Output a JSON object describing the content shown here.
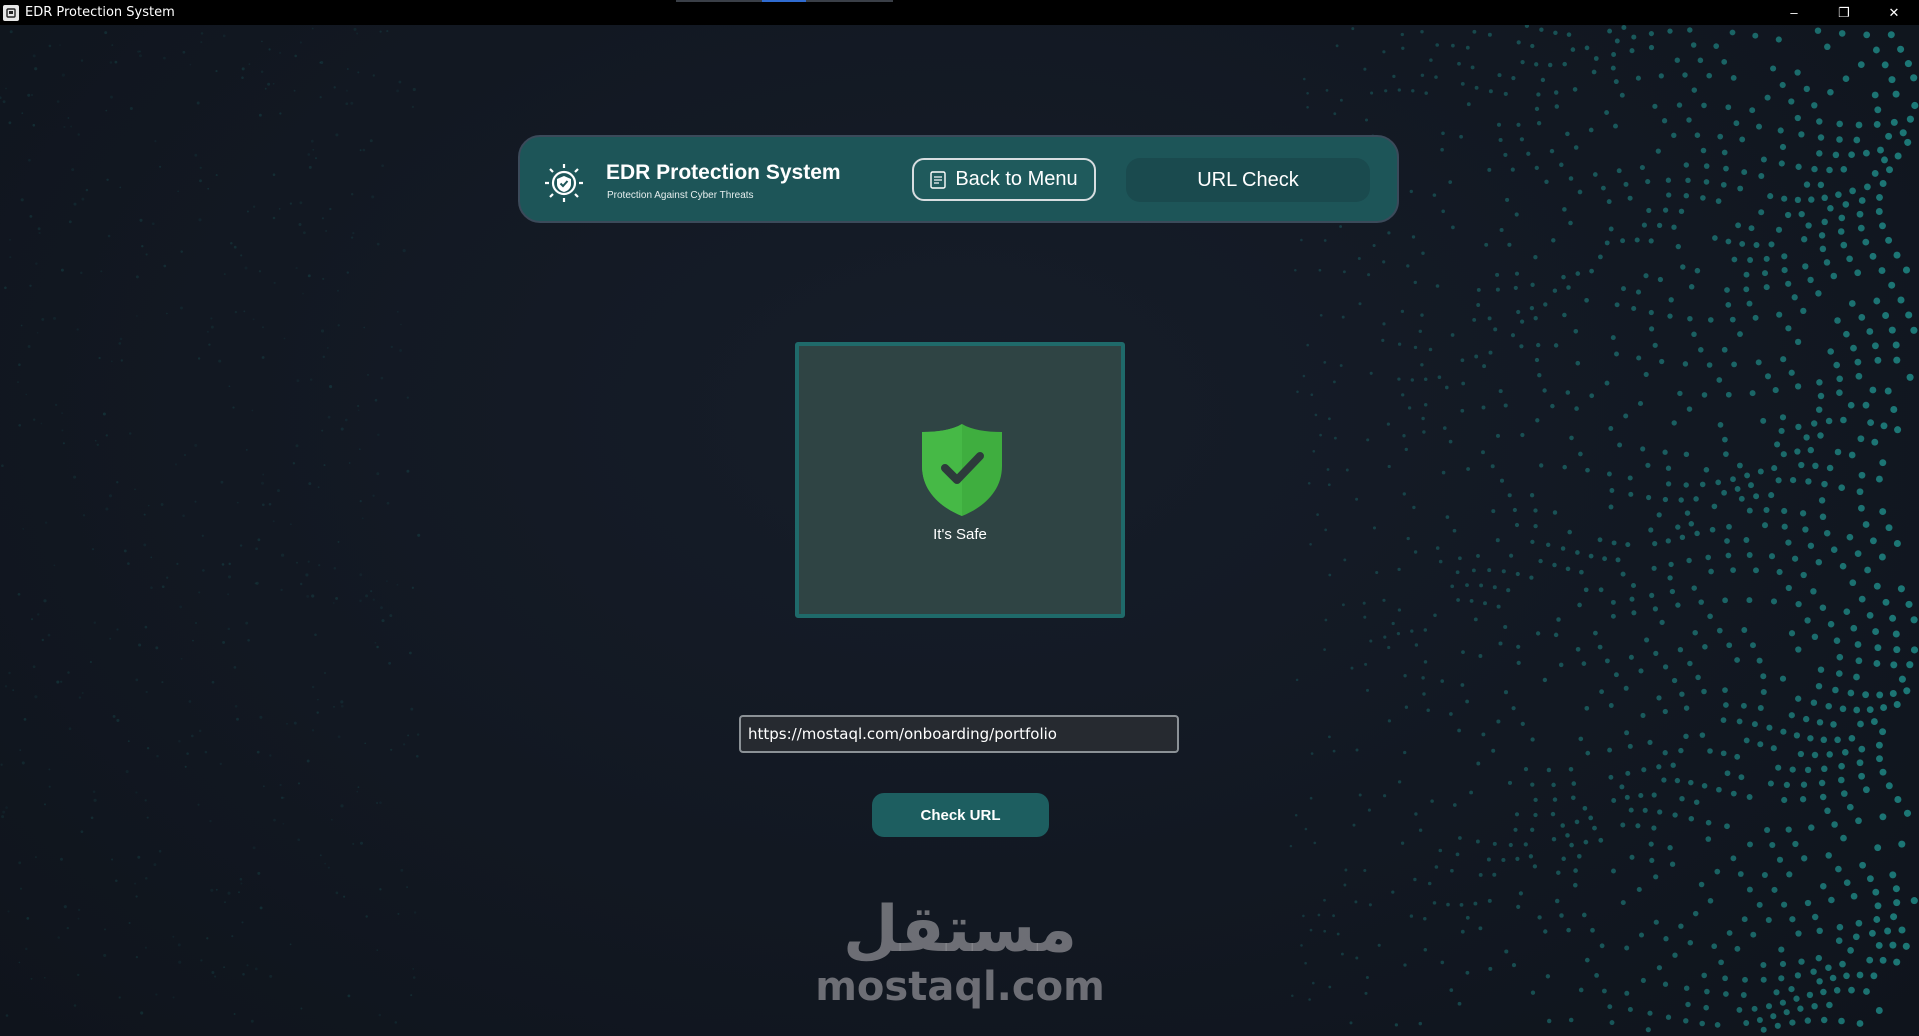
{
  "window": {
    "title": "EDR Protection System",
    "icon": "app-icon",
    "controls": {
      "minimize": "–",
      "restore": "❐",
      "close": "✕"
    }
  },
  "header": {
    "logo_icon": "shield-gear-icon",
    "title": "EDR Protection System",
    "subtitle": "Protection Against Cyber Threats",
    "back_button_label": "Back to Menu",
    "back_button_icon": "back-icon",
    "page_label": "URL Check"
  },
  "result": {
    "icon": "shield-check-icon",
    "status_text": "It's Safe",
    "status_color": "#3fae3f"
  },
  "url_input": {
    "value": "https://mostaql.com/onboarding/portfolio"
  },
  "check_button_label": "Check URL",
  "watermark": {
    "arabic": "مستقل",
    "latin": "mostaql.com"
  },
  "colors": {
    "background": "#121820",
    "header": "#1d5558",
    "accent": "#1d5e60",
    "dots": "#1f8a87"
  }
}
